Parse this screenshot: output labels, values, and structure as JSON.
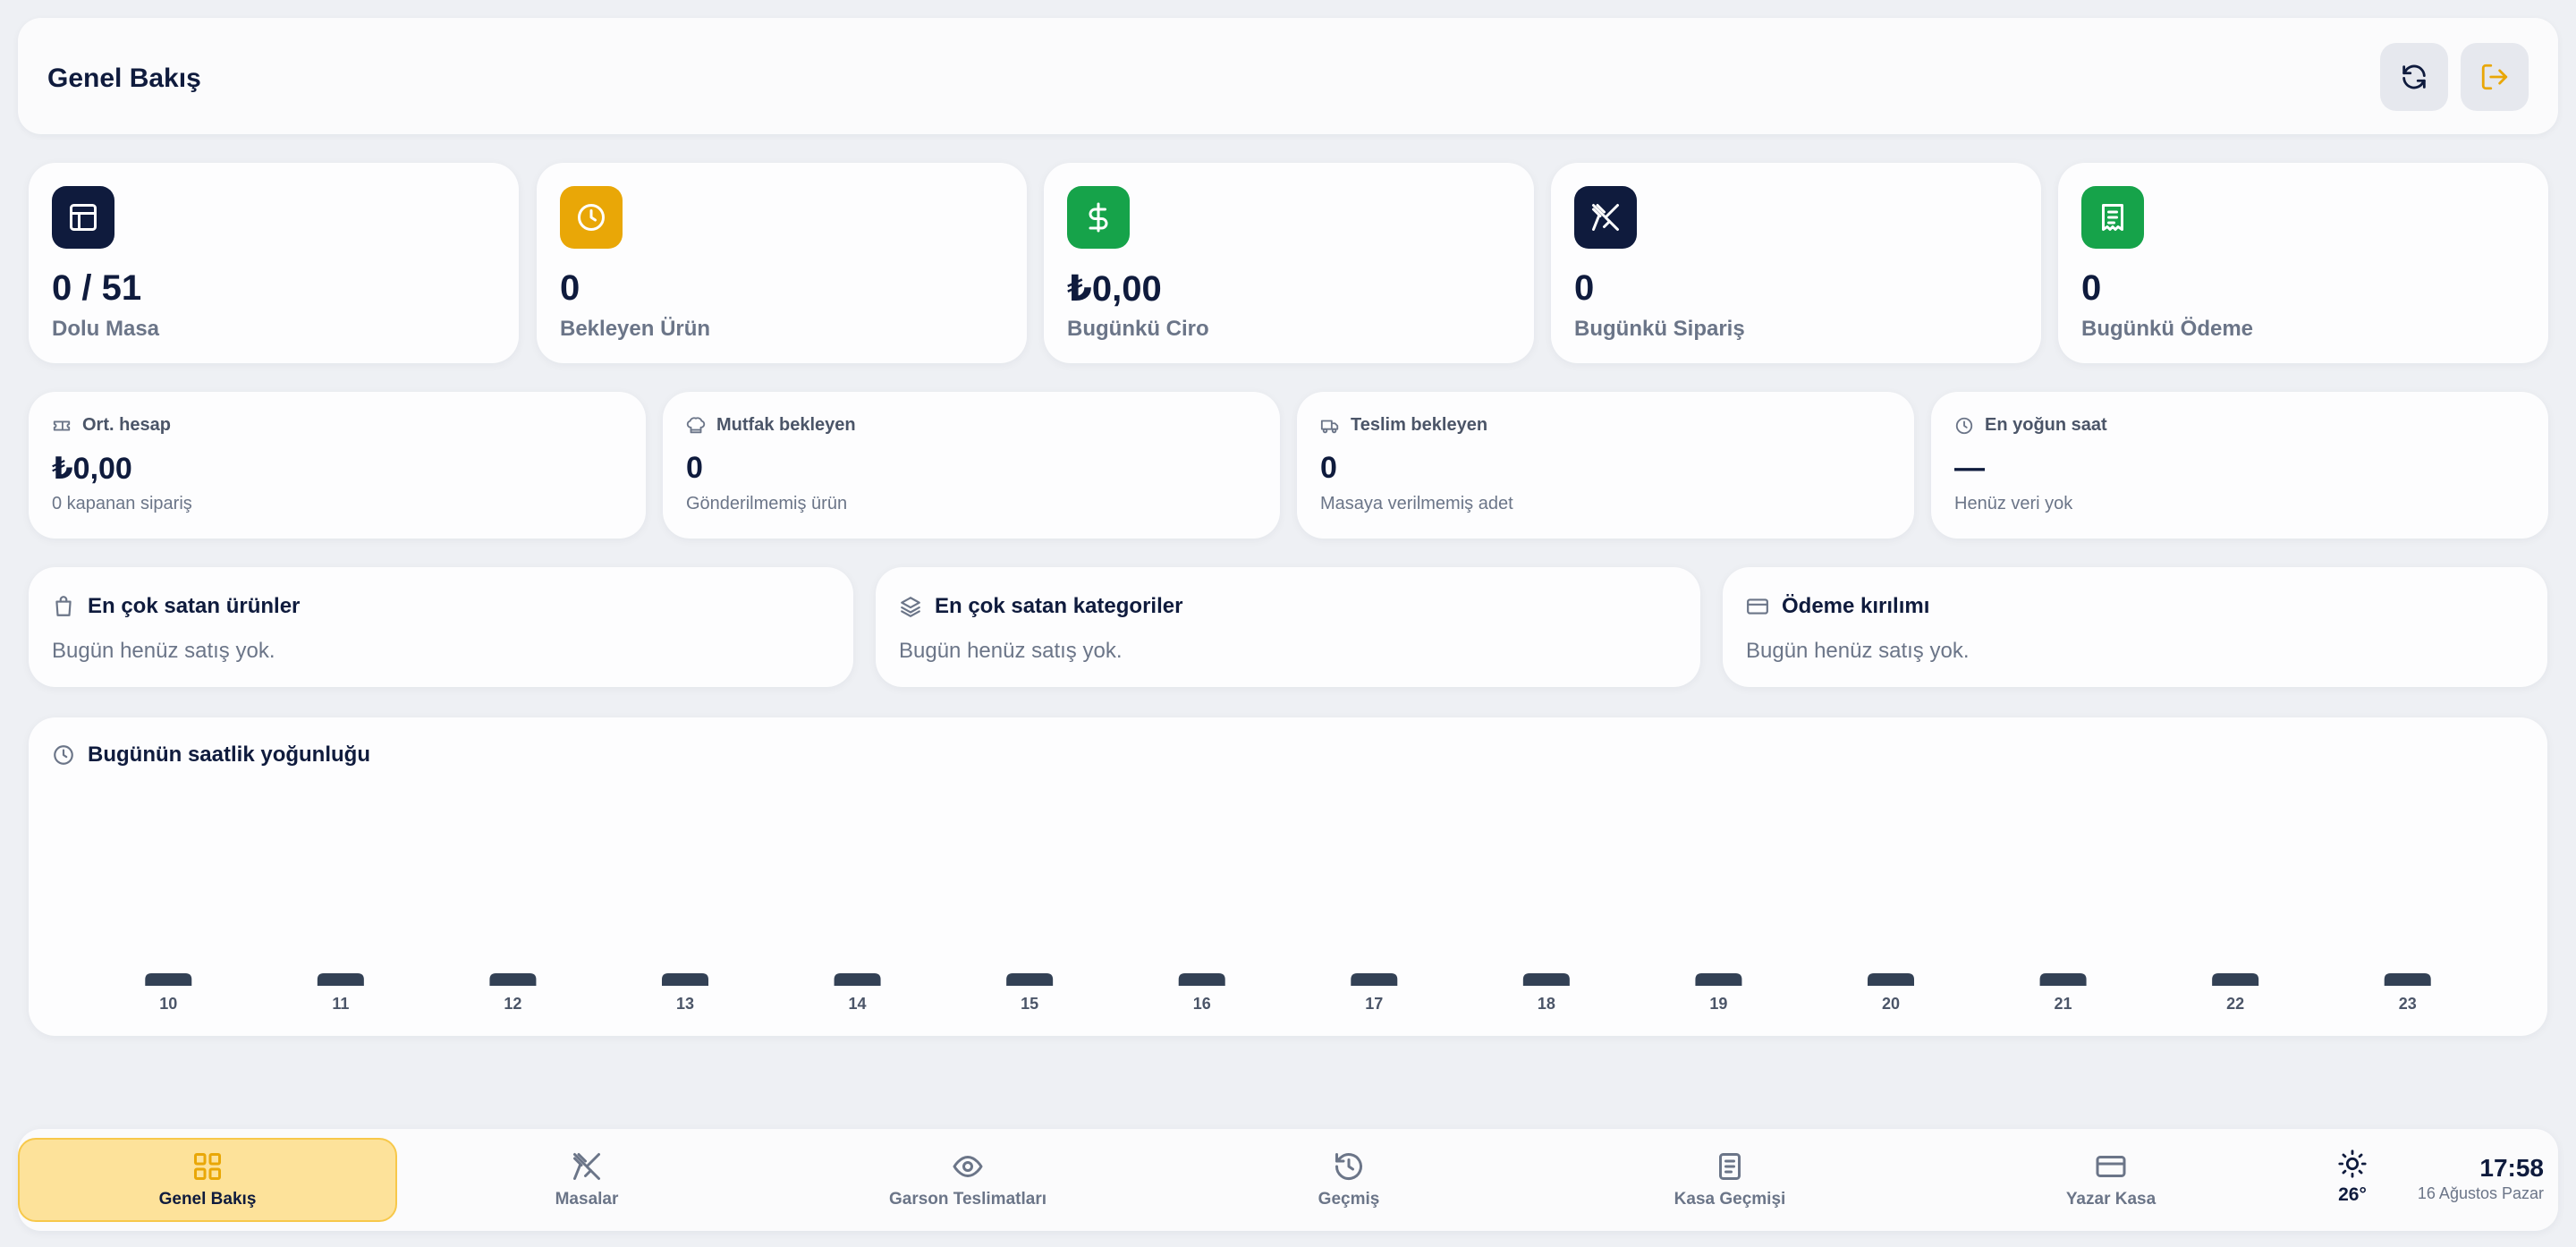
{
  "header": {
    "title": "Genel Bakış"
  },
  "stats": [
    {
      "value": "0 / 51",
      "label": "Dolu Masa",
      "color": "#0f1b3d",
      "icon": "table-icon"
    },
    {
      "value": "0",
      "label": "Bekleyen Ürün",
      "color": "#e9a707",
      "icon": "clock-icon"
    },
    {
      "value": "₺0,00",
      "label": "Bugünkü Ciro",
      "color": "#16a34a",
      "icon": "dollar-icon"
    },
    {
      "value": "0",
      "label": "Bugünkü Sipariş",
      "color": "#0f1b3d",
      "icon": "utensils-icon"
    },
    {
      "value": "0",
      "label": "Bugünkü Ödeme",
      "color": "#16a34a",
      "icon": "receipt-icon"
    }
  ],
  "metrics": [
    {
      "title": "Ort. hesap",
      "value": "₺0,00",
      "sub": "0 kapanan sipariş",
      "icon": "ticket-icon"
    },
    {
      "title": "Mutfak bekleyen",
      "value": "0",
      "sub": "Gönderilmemiş ürün",
      "icon": "chef-hat-icon"
    },
    {
      "title": "Teslim bekleyen",
      "value": "0",
      "sub": "Masaya verilmemiş adet",
      "icon": "truck-icon"
    },
    {
      "title": "En yoğun saat",
      "value": "—",
      "sub": "Henüz veri yok",
      "icon": "clock-icon"
    }
  ],
  "lists": [
    {
      "title": "En çok satan ürünler",
      "empty": "Bugün henüz satış yok.",
      "icon": "shopping-bag-icon"
    },
    {
      "title": "En çok satan kategoriler",
      "empty": "Bugün henüz satış yok.",
      "icon": "layers-icon"
    },
    {
      "title": "Ödeme kırılımı",
      "empty": "Bugün henüz satış yok.",
      "icon": "credit-card-icon"
    }
  ],
  "chart": {
    "title": "Bugünün saatlik yoğunluğu"
  },
  "chart_data": {
    "type": "bar",
    "categories": [
      "10",
      "11",
      "12",
      "13",
      "14",
      "15",
      "16",
      "17",
      "18",
      "19",
      "20",
      "21",
      "22",
      "23"
    ],
    "values": [
      0,
      0,
      0,
      0,
      0,
      0,
      0,
      0,
      0,
      0,
      0,
      0,
      0,
      0
    ],
    "title": "Bugünün saatlik yoğunluğu",
    "bar_color": "#334155"
  },
  "nav": [
    {
      "label": "Genel Bakış",
      "icon": "grid-icon",
      "active": true
    },
    {
      "label": "Masalar",
      "icon": "utensils-icon",
      "active": false
    },
    {
      "label": "Garson Teslimatları",
      "icon": "eye-icon",
      "active": false
    },
    {
      "label": "Geçmiş",
      "icon": "history-icon",
      "active": false
    },
    {
      "label": "Kasa Geçmişi",
      "icon": "clipboard-icon",
      "active": false
    },
    {
      "label": "Yazar Kasa",
      "icon": "credit-card-icon",
      "active": false
    }
  ],
  "weather": {
    "temp": "26°",
    "icon": "sun-icon"
  },
  "clock": {
    "time": "17:58",
    "date": "16 Ağustos Pazar"
  },
  "colors": {
    "accent": "#fde29a",
    "navy": "#0f1b3d",
    "amber": "#e9a707",
    "green": "#16a34a",
    "muted": "#6b7588"
  }
}
